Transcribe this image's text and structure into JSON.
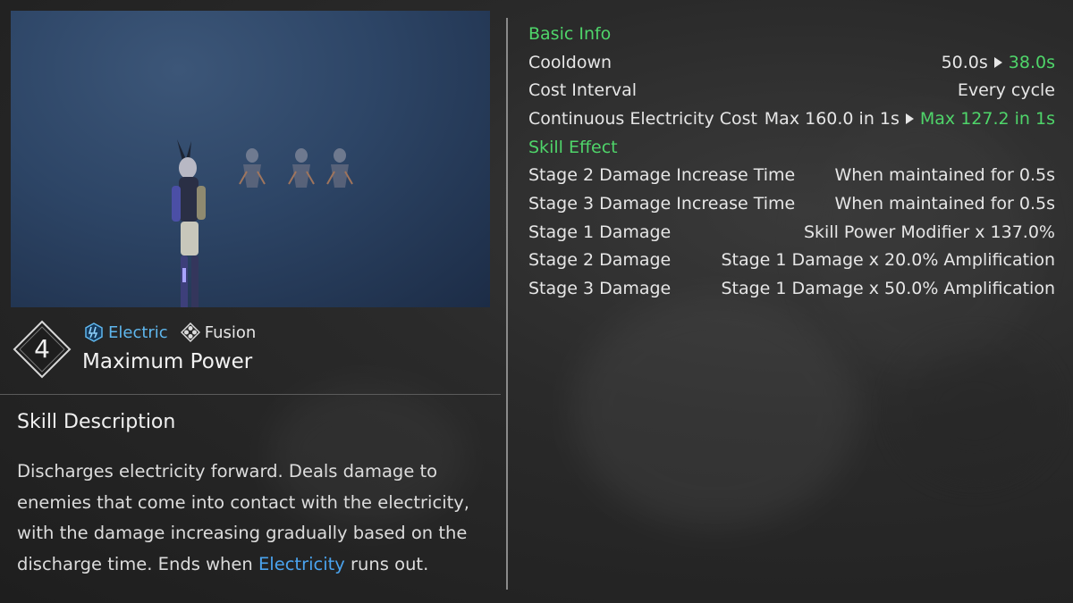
{
  "skill": {
    "level": "4",
    "element_tag": "Electric",
    "element_icon": "electric-icon",
    "type_tag": "Fusion",
    "type_icon": "fusion-icon",
    "name": "Maximum Power"
  },
  "description": {
    "title": "Skill Description",
    "text_before": "Discharges electricity forward. Deals damage to enemies that come into contact with the electricity, with the damage increasing gradually based on the discharge time. Ends when ",
    "highlight": "Electricity",
    "text_after": " runs out."
  },
  "stats": {
    "basic_info_title": "Basic Info",
    "cooldown": {
      "label": "Cooldown",
      "old": "50.0s",
      "new": "38.0s"
    },
    "cost_interval": {
      "label": "Cost Interval",
      "value": "Every cycle"
    },
    "electricity_cost": {
      "label": "Continuous Electricity Cost",
      "old": "Max 160.0 in 1s",
      "new": "Max 127.2 in 1s"
    },
    "skill_effect_title": "Skill Effect",
    "effects": [
      {
        "label": "Stage 2 Damage Increase Time",
        "value": "When maintained for 0.5s"
      },
      {
        "label": "Stage 3 Damage Increase Time",
        "value": "When maintained for 0.5s"
      },
      {
        "label": "Stage 1 Damage",
        "value": "Skill Power Modifier x 137.0%"
      },
      {
        "label": "Stage 2 Damage",
        "value": "Stage 1 Damage x 20.0% Amplification"
      },
      {
        "label": "Stage 3 Damage",
        "value": "Stage 1 Damage x 50.0% Amplification"
      }
    ]
  },
  "colors": {
    "section_green": "#4fd56a",
    "electric_blue": "#5fb7ee",
    "highlight_blue": "#4aa3ee"
  }
}
